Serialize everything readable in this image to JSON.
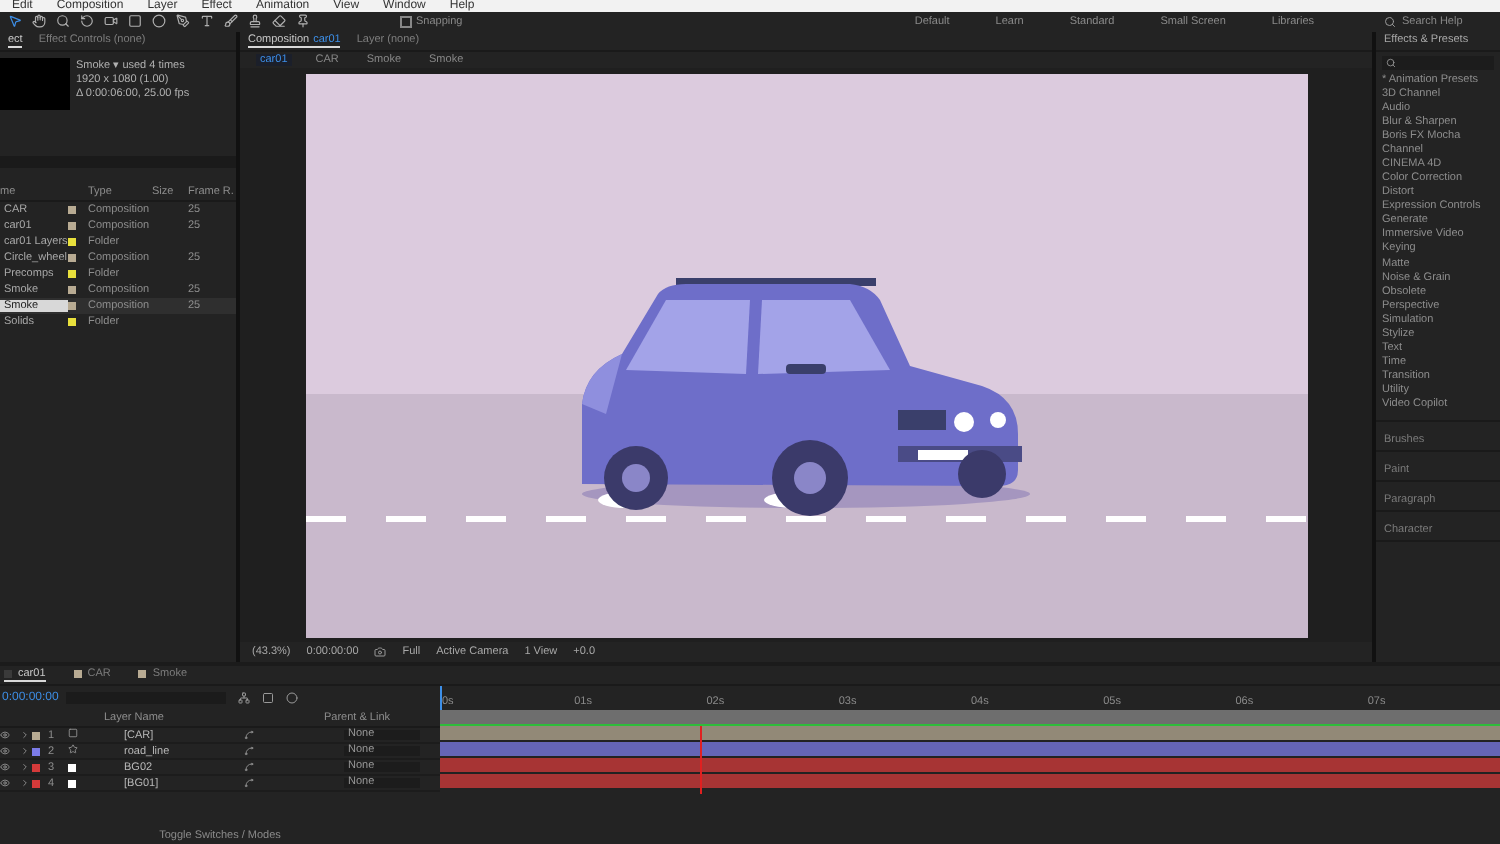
{
  "menu": [
    "Edit",
    "Composition",
    "Layer",
    "Effect",
    "Animation",
    "View",
    "Window",
    "Help"
  ],
  "toolbar": {
    "snapping": {
      "label": "Snapping",
      "checked": false
    },
    "workspaces": [
      {
        "label": "Default",
        "selected": false
      },
      {
        "label": "Learn",
        "selected": false
      },
      {
        "label": "Standard",
        "selected": false
      },
      {
        "label": "Small Screen",
        "selected": false
      },
      {
        "label": "Libraries",
        "selected": false
      }
    ],
    "search_help": "Search Help"
  },
  "project": {
    "tabs": [
      {
        "label": "ect",
        "selected": true
      },
      {
        "label": "Effect Controls (none)",
        "selected": false
      }
    ],
    "info": {
      "name": "Smoke ▾",
      "usage": "used 4 times",
      "size": "1920 x 1080 (1.00)",
      "duration": "Δ 0:00:06:00, 25.00 fps"
    },
    "columns": [
      "me",
      "Type",
      "Size",
      "Frame R."
    ],
    "rows": [
      {
        "name": "CAR",
        "type": "Composition",
        "frame_rate": "25",
        "color": "#b8ab93",
        "selected": false
      },
      {
        "name": "car01",
        "type": "Composition",
        "frame_rate": "25",
        "color": "#b8ab93",
        "selected": false
      },
      {
        "name": "car01 Layers",
        "type": "Folder",
        "color": "#e8e03c",
        "selected": false
      },
      {
        "name": "Circle_wheel",
        "type": "Composition",
        "frame_rate": "25",
        "color": "#b8ab93",
        "selected": false
      },
      {
        "name": "Precomps",
        "type": "Folder",
        "color": "#e8e03c",
        "selected": false
      },
      {
        "name": "Smoke",
        "type": "Composition",
        "frame_rate": "25",
        "color": "#b8ab93",
        "selected": false
      },
      {
        "name": "Smoke",
        "type": "Composition",
        "frame_rate": "25",
        "color": "#b8ab93",
        "selected": true
      },
      {
        "name": "Solids",
        "type": "Folder",
        "color": "#e8e03c",
        "selected": false
      }
    ]
  },
  "composition": {
    "tabs": [
      {
        "label": "Composition",
        "comp": "car01",
        "selected": true
      },
      {
        "label": "Layer (none)",
        "selected": false
      }
    ],
    "breadcrumbs": [
      {
        "label": "car01",
        "selected": true
      },
      {
        "label": "CAR",
        "selected": false
      },
      {
        "label": "Smoke",
        "selected": false
      },
      {
        "label": "Smoke",
        "selected": false
      }
    ],
    "viewer": {
      "zoom": "(43.3%)",
      "timecode": "0:00:00:00",
      "resolution": "Full",
      "camera": "Active Camera",
      "views": "1 View",
      "exposure": "+0.0"
    }
  },
  "effects": {
    "title": "Effects & Presets",
    "items": [
      "* Animation Presets",
      "3D Channel",
      "Audio",
      "Blur & Sharpen",
      "Boris FX Mocha",
      "Channel",
      "CINEMA 4D",
      "Color Correction",
      "Distort",
      "Expression Controls",
      "Generate",
      "Immersive Video",
      "Keying",
      "Matte",
      "Noise & Grain",
      "Obsolete",
      "Perspective",
      "Simulation",
      "Stylize",
      "Text",
      "Time",
      "Transition",
      "Utility",
      "Video Copilot"
    ],
    "panels": [
      "Brushes",
      "Paint",
      "Paragraph",
      "Character"
    ]
  },
  "timeline": {
    "tabs": [
      {
        "label": "car01",
        "selected": true,
        "color": "#3a3a3a"
      },
      {
        "label": "CAR",
        "selected": false,
        "color": "#b8ab93"
      },
      {
        "label": "Smoke",
        "selected": false,
        "color": "#b8ab93"
      }
    ],
    "timecode": "0:00:00:00",
    "columns": {
      "name": "Layer Name",
      "parent": "Parent & Link"
    },
    "layers": [
      {
        "number": "1",
        "name": "[CAR]",
        "kind": "comp",
        "color": "#b8ab93",
        "parent": "None"
      },
      {
        "number": "2",
        "name": "road_line",
        "kind": "shape",
        "color": "#7b7be8",
        "parent": "None"
      },
      {
        "number": "3",
        "name": "BG02",
        "kind": "solid",
        "color": "#d43a3a",
        "parent": "None"
      },
      {
        "number": "4",
        "name": "[BG01]",
        "kind": "solid",
        "color": "#d43a3a",
        "parent": "None"
      }
    ],
    "ruler": [
      "0s",
      "01s",
      "02s",
      "03s",
      "04s",
      "05s",
      "06s",
      "07s"
    ],
    "footer": "Toggle Switches / Modes"
  }
}
